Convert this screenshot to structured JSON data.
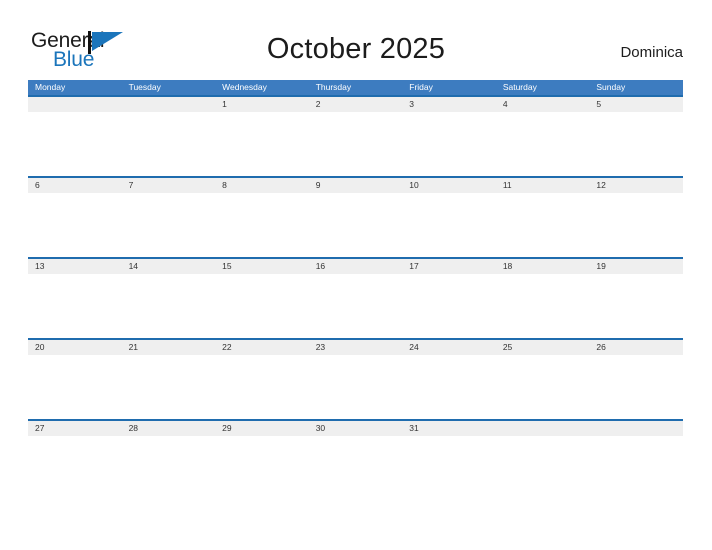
{
  "brand": {
    "name_top": "General",
    "name_bottom": "Blue",
    "accent_color": "#1b75bb"
  },
  "header": {
    "title": "October 2025",
    "country": "Dominica"
  },
  "theme": {
    "header_blue": "#3d7cc0",
    "rule_blue": "#1f6cae",
    "band_gray": "#efefef",
    "text_dark": "#333333"
  },
  "calendar": {
    "weekday_headers": [
      "Monday",
      "Tuesday",
      "Wednesday",
      "Thursday",
      "Friday",
      "Saturday",
      "Sunday"
    ],
    "weeks": [
      [
        "",
        "",
        "1",
        "2",
        "3",
        "4",
        "5"
      ],
      [
        "6",
        "7",
        "8",
        "9",
        "10",
        "11",
        "12"
      ],
      [
        "13",
        "14",
        "15",
        "16",
        "17",
        "18",
        "19"
      ],
      [
        "20",
        "21",
        "22",
        "23",
        "24",
        "25",
        "26"
      ],
      [
        "27",
        "28",
        "29",
        "30",
        "31",
        "",
        ""
      ]
    ]
  }
}
